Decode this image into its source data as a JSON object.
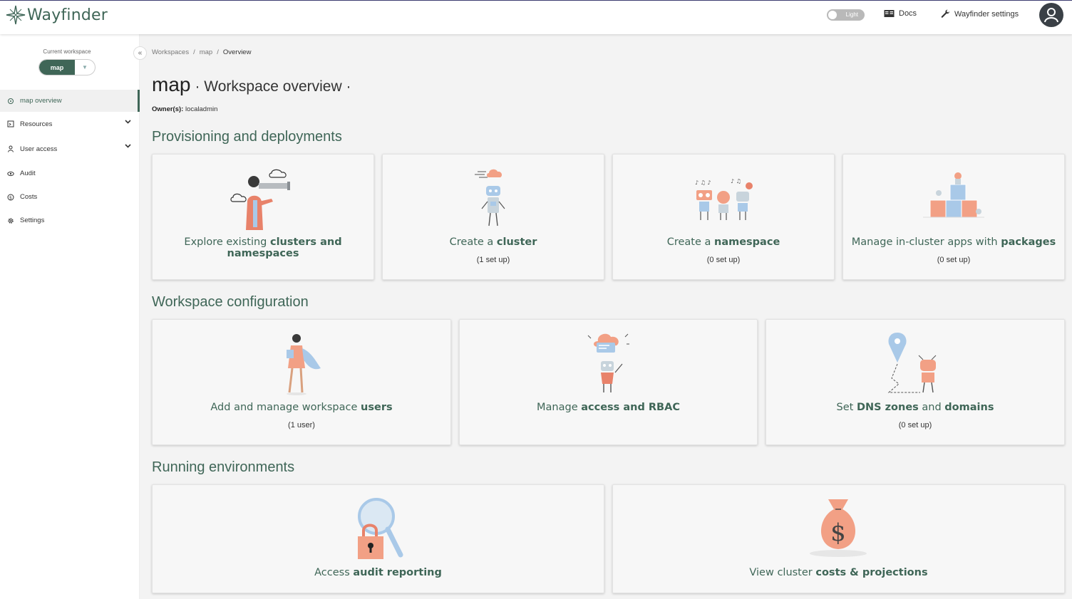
{
  "header": {
    "app_name": "Wayfinder",
    "theme_toggle_label": "Light",
    "docs_label": "Docs",
    "settings_label": "Wayfinder settings"
  },
  "sidebar": {
    "workspace_label": "Current workspace",
    "workspace_value": "map",
    "items": [
      {
        "label": "map overview",
        "icon": "location-pin-icon",
        "active": true
      },
      {
        "label": "Resources",
        "icon": "resources-icon",
        "expandable": true
      },
      {
        "label": "User access",
        "icon": "user-icon",
        "expandable": true
      },
      {
        "label": "Audit",
        "icon": "eye-icon"
      },
      {
        "label": "Costs",
        "icon": "dollar-icon"
      },
      {
        "label": "Settings",
        "icon": "gear-icon"
      }
    ]
  },
  "breadcrumb": {
    "items": [
      "Workspaces",
      "map",
      "Overview"
    ],
    "separator": "/"
  },
  "page": {
    "workspace_name": "map",
    "title_rest": "· Workspace overview ·",
    "owner_label": "Owner(s):",
    "owner_value": "localadmin"
  },
  "sections": {
    "provisioning": "Provisioning and deployments",
    "configuration": "Workspace configuration",
    "running": "Running environments"
  },
  "cards": {
    "explore": {
      "pre": "Explore existing ",
      "bold": "clusters and namespaces",
      "post": "",
      "sub": ""
    },
    "cluster": {
      "pre": "Create a ",
      "bold": "cluster",
      "post": "",
      "sub": "(1 set up)"
    },
    "namespace": {
      "pre": "Create a ",
      "bold": "namespace",
      "post": "",
      "sub": "(0 set up)"
    },
    "packages": {
      "pre": "Manage in-cluster apps with ",
      "bold": "packages",
      "post": "",
      "sub": "(0 set up)"
    },
    "users": {
      "pre": "Add and manage workspace ",
      "bold": "users",
      "post": "",
      "sub": "(1 user)"
    },
    "rbac": {
      "pre": "Manage ",
      "bold": "access and RBAC",
      "post": "",
      "sub": ""
    },
    "dns": {
      "pre": "Set ",
      "bold": "DNS zones",
      "mid": " and ",
      "bold2": "domains",
      "sub": "(0 set up)"
    },
    "audit": {
      "pre": "Access ",
      "bold": "audit reporting",
      "post": "",
      "sub": ""
    },
    "costs": {
      "pre": "View cluster ",
      "bold": "costs & projections",
      "post": "",
      "sub": ""
    }
  },
  "colors": {
    "brand": "#3f6657",
    "accent_orange": "#f2a085",
    "illus_blue": "#a9c9e8",
    "background": "#f3f3f3"
  }
}
